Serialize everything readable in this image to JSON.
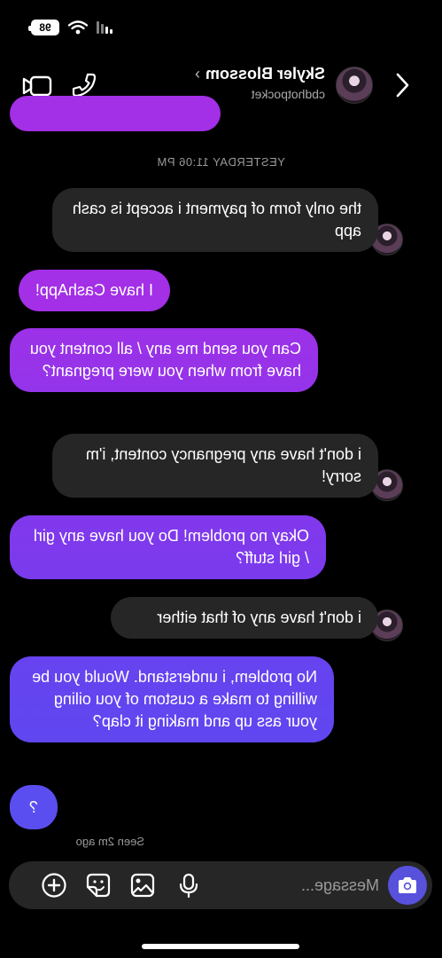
{
  "status": {
    "battery": "98"
  },
  "header": {
    "contact_name": "Skyler Blossom",
    "contact_handle": "cbdhotpocket",
    "chevron": "›"
  },
  "conversation": {
    "date_separator": "YESTERDAY 11:06 PM",
    "messages": [
      {
        "from": "them",
        "text": "the only form of payment i accept is cash app"
      },
      {
        "from": "me",
        "text": "I have CashApp!"
      },
      {
        "from": "me",
        "text": "Can you send me any / all content you have from when you were pregnant?"
      },
      {
        "from": "them",
        "text": "i don't have any pregnancy content, i'm sorry!"
      },
      {
        "from": "me",
        "text": "Okay no problem! Do you have any girl / girl stuff?"
      },
      {
        "from": "them",
        "text": "i don't have any of that either"
      },
      {
        "from": "me",
        "text": "No problem, i understand. Would you be willing to make a custom of you oiling your ass up and making it clap?"
      },
      {
        "from": "me",
        "text": "?"
      }
    ],
    "seen_text": "Seen 2m ago"
  },
  "composer": {
    "placeholder": "Message..."
  },
  "colors": {
    "background": "#000000",
    "incoming_bubble": "#262626",
    "outgoing_top": "#a32fe6",
    "outgoing_bottom": "#5b4ef0",
    "camera_button": "#5851db"
  },
  "icons": [
    "back-icon",
    "phone-icon",
    "video-camera-icon",
    "camera-icon",
    "microphone-icon",
    "gallery-icon",
    "sticker-icon",
    "plus-icon",
    "wifi-icon",
    "signal-icon"
  ]
}
